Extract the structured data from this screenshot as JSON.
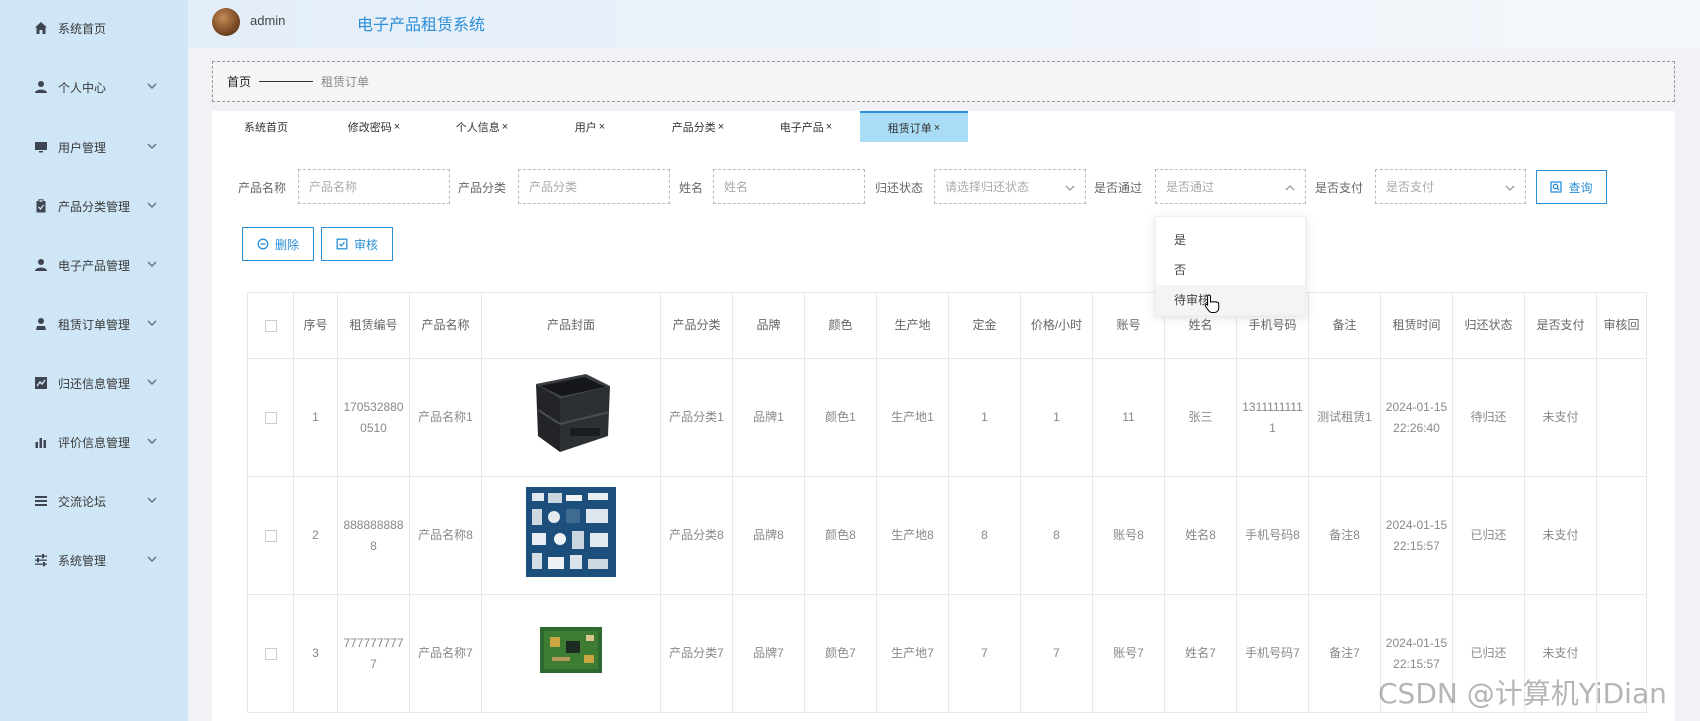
{
  "sidebar": {
    "items": [
      {
        "label": "系统首页",
        "icon": "home-icon"
      },
      {
        "label": "个人中心",
        "icon": "user-icon"
      },
      {
        "label": "用户管理",
        "icon": "monitor-icon"
      },
      {
        "label": "产品分类管理",
        "icon": "clipboard-icon"
      },
      {
        "label": "电子产品管理",
        "icon": "user-icon"
      },
      {
        "label": "租赁订单管理",
        "icon": "user-icon"
      },
      {
        "label": "归还信息管理",
        "icon": "chart-icon"
      },
      {
        "label": "评价信息管理",
        "icon": "bar-chart-icon"
      },
      {
        "label": "交流论坛",
        "icon": "list-icon"
      },
      {
        "label": "系统管理",
        "icon": "sliders-icon"
      }
    ]
  },
  "header": {
    "username": "admin",
    "title": "电子产品租赁系统"
  },
  "breadcrumb": {
    "home": "首页",
    "current": "租赁订单"
  },
  "tabs": [
    {
      "label": "系统首页",
      "close": ""
    },
    {
      "label": "修改密码",
      "close": "×"
    },
    {
      "label": "个人信息",
      "close": "×"
    },
    {
      "label": "用户",
      "close": "×"
    },
    {
      "label": "产品分类",
      "close": "×"
    },
    {
      "label": "电子产品",
      "close": "×"
    },
    {
      "label": "租赁订单",
      "close": "×"
    }
  ],
  "search": {
    "fields": [
      {
        "label": "产品名称",
        "placeholder": "产品名称"
      },
      {
        "label": "产品分类",
        "placeholder": "产品分类"
      },
      {
        "label": "姓名",
        "placeholder": "姓名"
      },
      {
        "label": "归还状态",
        "placeholder": "请选择归还状态"
      },
      {
        "label": "是否通过",
        "placeholder": "是否通过"
      },
      {
        "label": "是否支付",
        "placeholder": "是否支付"
      }
    ],
    "query_label": "查询"
  },
  "actions": {
    "delete_label": "删除",
    "review_label": "审核"
  },
  "dropdown": {
    "options": [
      "是",
      "否",
      "待审核"
    ],
    "hovered": "待审核"
  },
  "table": {
    "headers": [
      "序号",
      "租赁编号",
      "产品名称",
      "产品封面",
      "产品分类",
      "品牌",
      "颜色",
      "生产地",
      "定金",
      "价格/小时",
      "账号",
      "姓名",
      "手机号码",
      "备注",
      "租赁时间",
      "归还状态",
      "是否支付",
      "审核回"
    ],
    "rows": [
      {
        "idx": "1",
        "no": "1705328800510",
        "name": "产品名称1",
        "image": "storage-crate-image",
        "category": "产品分类1",
        "brand": "品牌1",
        "color": "颜色1",
        "origin": "生产地1",
        "deposit": "1",
        "price": "1",
        "account": "11",
        "person": "张三",
        "phone": "13111111111",
        "remark": "测试租赁1",
        "time": "2024-01-15 22:26:40",
        "return": "待归还",
        "paid": "未支付",
        "reply": ""
      },
      {
        "idx": "2",
        "no": "8888888888",
        "name": "产品名称8",
        "image": "electronics-grid-image",
        "category": "产品分类8",
        "brand": "品牌8",
        "color": "颜色8",
        "origin": "生产地8",
        "deposit": "8",
        "price": "8",
        "account": "账号8",
        "person": "姓名8",
        "phone": "手机号码8",
        "remark": "备注8",
        "time": "2024-01-15 22:15:57",
        "return": "已归还",
        "paid": "未支付",
        "reply": ""
      },
      {
        "idx": "3",
        "no": "7777777777",
        "name": "产品名称7",
        "image": "circuit-board-image",
        "category": "产品分类7",
        "brand": "品牌7",
        "color": "颜色7",
        "origin": "生产地7",
        "deposit": "7",
        "price": "7",
        "account": "账号7",
        "person": "姓名7",
        "phone": "手机号码7",
        "remark": "备注7",
        "time": "2024-01-15 22:15:57",
        "return": "已归还",
        "paid": "未支付",
        "reply": ""
      }
    ]
  },
  "watermark": "CSDN @计算机YiDian",
  "colors": {
    "sidebar_bg": "#cfe6f6",
    "accent": "#2c8fd8",
    "active_tab": "#a9dcf5"
  }
}
